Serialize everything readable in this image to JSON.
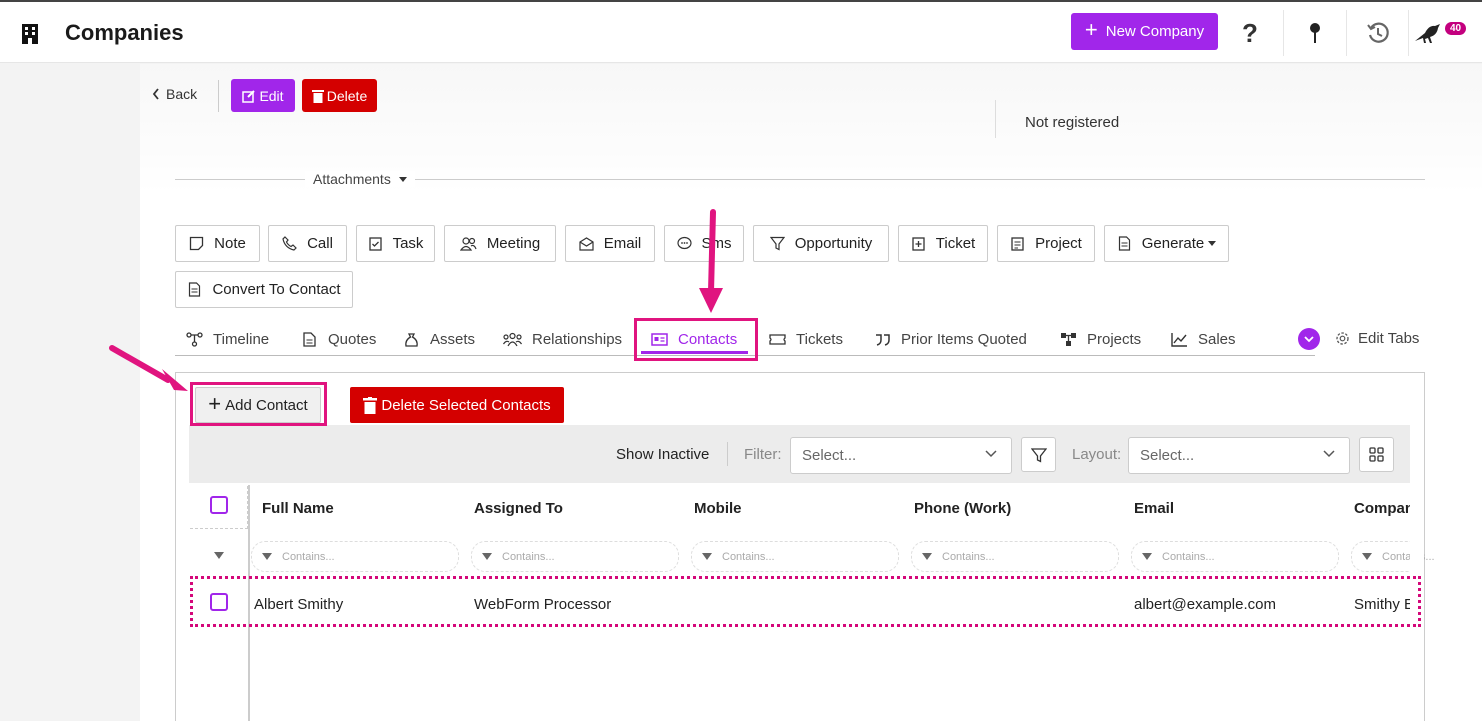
{
  "header": {
    "title": "Companies",
    "new_company_label": "New Company",
    "notification_count": "40"
  },
  "record": {
    "back_label": "Back",
    "edit_label": "Edit",
    "delete_label": "Delete",
    "status_text": "Not registered",
    "attachments_label": "Attachments"
  },
  "actions": [
    {
      "label": "Note",
      "icon": "note-icon"
    },
    {
      "label": "Call",
      "icon": "phone-icon"
    },
    {
      "label": "Task",
      "icon": "task-icon"
    },
    {
      "label": "Meeting",
      "icon": "meeting-icon"
    },
    {
      "label": "Email",
      "icon": "email-icon"
    },
    {
      "label": "Sms",
      "icon": "sms-icon"
    },
    {
      "label": "Opportunity",
      "icon": "filter-icon"
    },
    {
      "label": "Ticket",
      "icon": "ticket-icon"
    },
    {
      "label": "Project",
      "icon": "project-icon"
    },
    {
      "label": "Generate",
      "icon": "document-icon"
    },
    {
      "label": "Convert To Contact",
      "icon": "document-icon"
    }
  ],
  "tabs": [
    {
      "label": "Timeline",
      "icon": "timeline-icon"
    },
    {
      "label": "Quotes",
      "icon": "quote-icon"
    },
    {
      "label": "Assets",
      "icon": "assets-icon"
    },
    {
      "label": "Relationships",
      "icon": "relationships-icon"
    },
    {
      "label": "Contacts",
      "icon": "contact-card-icon",
      "active": true
    },
    {
      "label": "Tickets",
      "icon": "ticket-icon"
    },
    {
      "label": "Prior Items Quoted",
      "icon": "quote-marks-icon"
    },
    {
      "label": "Projects",
      "icon": "projects-icon"
    },
    {
      "label": "Sales",
      "icon": "chart-icon"
    }
  ],
  "edit_tabs_label": "Edit Tabs",
  "contacts_grid": {
    "add_label": "Add Contact",
    "delete_selected_label": "Delete Selected Contacts",
    "show_inactive_label": "Show Inactive",
    "filter_label": "Filter:",
    "filter_placeholder": "Select...",
    "layout_label": "Layout:",
    "layout_placeholder": "Select...",
    "columns": [
      "Full Name",
      "Assigned To",
      "Mobile",
      "Phone (Work)",
      "Email",
      "Compan"
    ],
    "filter_placeholder_text": "Contains...",
    "rows": [
      {
        "full_name": "Albert Smithy",
        "assigned_to": "WebForm Processor",
        "mobile": "",
        "phone_work": "",
        "email": "albert@example.com",
        "company": "Smithy E"
      }
    ]
  },
  "colors": {
    "accent": "#a126ea",
    "danger": "#d40000",
    "annotation": "#e0147f"
  }
}
